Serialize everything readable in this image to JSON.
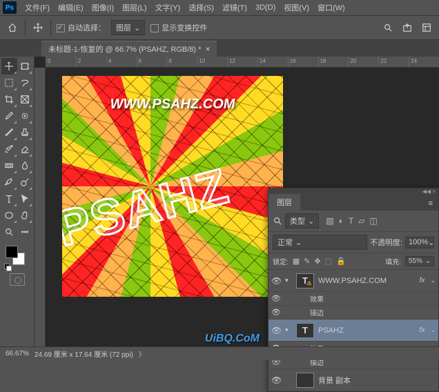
{
  "menu": {
    "file": "文件(F)",
    "edit": "编辑(E)",
    "image": "图像(I)",
    "layer": "图层(L)",
    "type": "文字(Y)",
    "select": "选择(S)",
    "filter": "滤镜(T)",
    "3d": "3D(D)",
    "view": "视图(V)",
    "window": "窗口(W)"
  },
  "options": {
    "auto_select": "自动选择：",
    "target": "图层",
    "show_transform": "显示变换控件"
  },
  "doc_tab": {
    "title": "未标题-1-恢复的 @ 66.7% (PSAHZ, RGB/8) *"
  },
  "ruler": {
    "marks": [
      "0",
      "2",
      "4",
      "6",
      "8",
      "10",
      "12",
      "14",
      "16",
      "18",
      "20",
      "22",
      "24"
    ]
  },
  "canvas": {
    "url": "WWW.PSAHZ.COM",
    "big": "PSAHZ"
  },
  "layers_panel": {
    "title": "图层",
    "kind": "类型",
    "blend": "正常",
    "opacity_label": "不透明度:",
    "opacity": "100%",
    "lock_label": "锁定:",
    "fill_label": "填充:",
    "fill": "55%",
    "items": [
      {
        "name": "WWW.PSAHZ.COM",
        "thumb": "T",
        "warn": true,
        "fx": true,
        "visible": true,
        "selected": false,
        "sub": [
          {
            "label": "效果",
            "visible": true
          },
          {
            "label": "描边",
            "visible": true
          }
        ]
      },
      {
        "name": "PSAHZ",
        "thumb": "T",
        "warn": false,
        "fx": true,
        "visible": true,
        "selected": true,
        "sub": [
          {
            "label": "效果",
            "visible": true
          },
          {
            "label": "描边",
            "visible": true
          }
        ]
      },
      {
        "name": "背景 副本",
        "thumb": "img",
        "visible": true
      }
    ]
  },
  "status": {
    "zoom": "66.67%",
    "dims": "24.69 厘米 x 17.64 厘米 (72 ppi)"
  },
  "watermark": "UiBQ.CoM",
  "icons": {
    "move": "move-icon",
    "artboard": "artboard-icon",
    "marquee": "marquee-icon",
    "lasso": "lasso-icon",
    "magic": "magic-wand-icon",
    "crop": "crop-icon",
    "slice": "slice-icon",
    "frame": "frame-icon",
    "eyedrop": "eyedropper-icon",
    "patch": "patch-icon",
    "brush": "brush-icon",
    "stamp": "stamp-icon",
    "history": "history-brush-icon",
    "eraser": "eraser-icon",
    "gradient": "gradient-icon",
    "blur": "blur-icon",
    "dodge": "dodge-icon",
    "pen": "pen-icon",
    "type": "type-icon",
    "path": "path-select-icon",
    "shape": "shape-icon",
    "hand": "hand-icon",
    "rotate": "rotate-view-icon",
    "zoom": "zoom-icon",
    "edit": "edit-toolbar-icon"
  }
}
